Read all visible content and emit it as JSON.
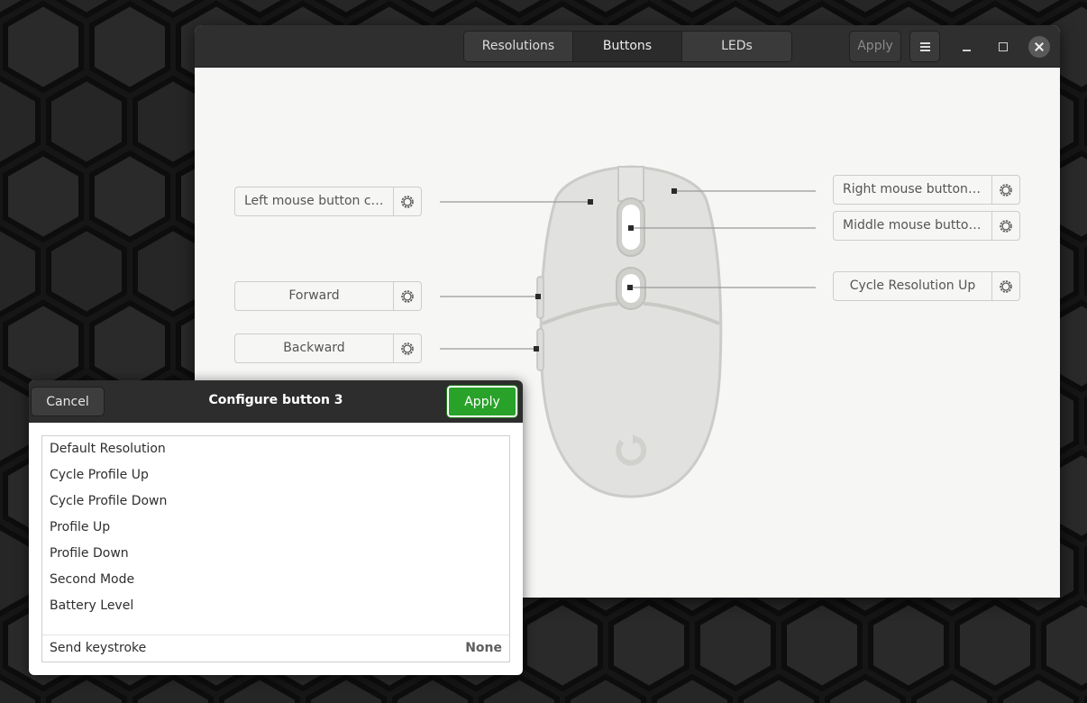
{
  "colors": {
    "desktop_bg": "#1c1c1c",
    "headerbar": "#2f2f2f",
    "window_content": "#f6f6f5",
    "mouse_body": "#e1e1df",
    "mouse_outline": "#c9c9c6",
    "apply_green": "#28a228"
  },
  "headerbar": {
    "tabs": [
      {
        "label": "Resolutions",
        "icon": "",
        "active": false
      },
      {
        "label": "Buttons",
        "icon": "",
        "active": true
      },
      {
        "label": "LEDs",
        "icon": "",
        "active": false
      }
    ],
    "apply_label": "Apply",
    "menu_icon": "hamburger-menu-icon",
    "controls": [
      "minimize-icon",
      "maximize-icon",
      "close-icon"
    ]
  },
  "buttons": {
    "left_click": "Left mouse button click",
    "forward": "Forward",
    "backward": "Backward",
    "right_click": "Right mouse button c…",
    "middle_click": "Middle mouse button…",
    "cycle_res": "Cycle Resolution Up",
    "gear_icon": "gear-icon"
  },
  "popover": {
    "cancel_label": "Cancel",
    "title": "Configure button 3",
    "apply_label": "Apply",
    "items": [
      "Default Resolution",
      "Cycle Profile Up",
      "Cycle Profile Down",
      "Profile Up",
      "Profile Down",
      "Second Mode",
      "Battery Level"
    ],
    "keystroke_label": "Send keystroke",
    "keystroke_value": "None"
  }
}
